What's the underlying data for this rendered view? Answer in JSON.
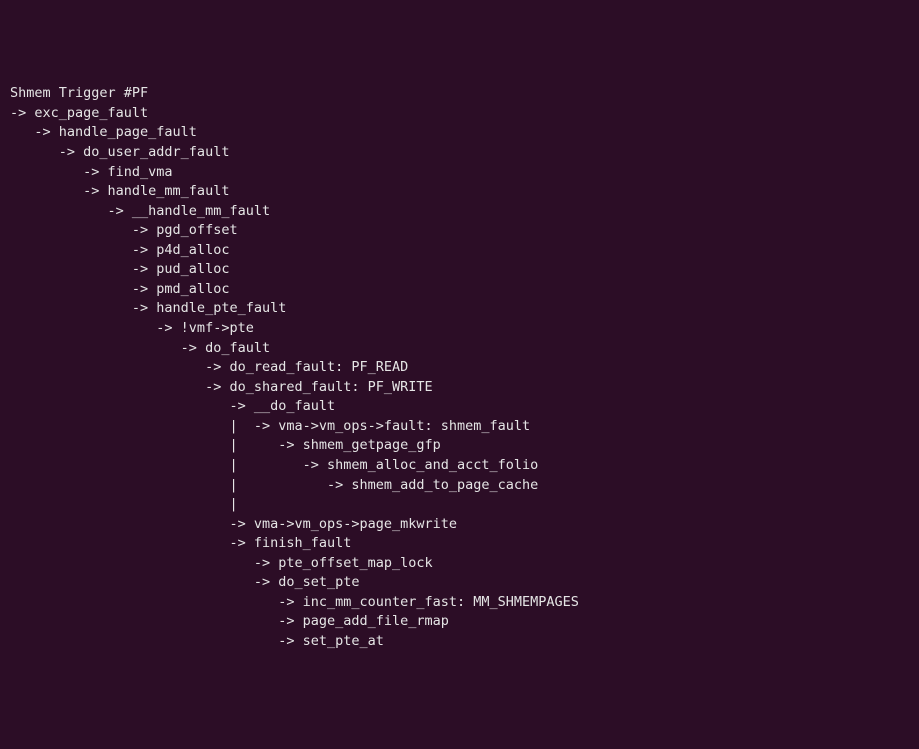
{
  "lines": [
    {
      "indent": 0,
      "prefix": "",
      "text": "Shmem Trigger #PF"
    },
    {
      "indent": 0,
      "prefix": "-> ",
      "text": "exc_page_fault"
    },
    {
      "indent": 1,
      "prefix": "-> ",
      "text": "handle_page_fault"
    },
    {
      "indent": 2,
      "prefix": "-> ",
      "text": "do_user_addr_fault"
    },
    {
      "indent": 3,
      "prefix": "-> ",
      "text": "find_vma"
    },
    {
      "indent": 3,
      "prefix": "-> ",
      "text": "handle_mm_fault"
    },
    {
      "indent": 4,
      "prefix": "-> ",
      "text": "__handle_mm_fault"
    },
    {
      "indent": 5,
      "prefix": "-> ",
      "text": "pgd_offset"
    },
    {
      "indent": 5,
      "prefix": "-> ",
      "text": "p4d_alloc"
    },
    {
      "indent": 5,
      "prefix": "-> ",
      "text": "pud_alloc"
    },
    {
      "indent": 5,
      "prefix": "-> ",
      "text": "pmd_alloc"
    },
    {
      "indent": 5,
      "prefix": "-> ",
      "text": "handle_pte_fault"
    },
    {
      "indent": 6,
      "prefix": "-> ",
      "text": "!vmf->pte"
    },
    {
      "indent": 7,
      "prefix": "-> ",
      "text": "do_fault"
    },
    {
      "indent": 8,
      "prefix": "-> ",
      "text": "do_read_fault: PF_READ"
    },
    {
      "indent": 8,
      "prefix": "-> ",
      "text": "do_shared_fault: PF_WRITE"
    },
    {
      "indent": 9,
      "prefix": "-> ",
      "text": "__do_fault"
    },
    {
      "indent": 9,
      "prefix": "|  -> ",
      "text": "vma->vm_ops->fault: shmem_fault"
    },
    {
      "indent": 9,
      "prefix": "|     -> ",
      "text": "shmem_getpage_gfp"
    },
    {
      "indent": 9,
      "prefix": "|        -> ",
      "text": "shmem_alloc_and_acct_folio"
    },
    {
      "indent": 9,
      "prefix": "|           -> ",
      "text": "shmem_add_to_page_cache"
    },
    {
      "indent": 9,
      "prefix": "|",
      "text": ""
    },
    {
      "indent": 9,
      "prefix": "-> ",
      "text": "vma->vm_ops->page_mkwrite"
    },
    {
      "indent": 9,
      "prefix": "-> ",
      "text": "finish_fault"
    },
    {
      "indent": 10,
      "prefix": "-> ",
      "text": "pte_offset_map_lock"
    },
    {
      "indent": 10,
      "prefix": "-> ",
      "text": "do_set_pte"
    },
    {
      "indent": 11,
      "prefix": "-> ",
      "text": "inc_mm_counter_fast: MM_SHMEMPAGES"
    },
    {
      "indent": 11,
      "prefix": "-> ",
      "text": "page_add_file_rmap"
    },
    {
      "indent": 11,
      "prefix": "-> ",
      "text": "set_pte_at"
    }
  ]
}
